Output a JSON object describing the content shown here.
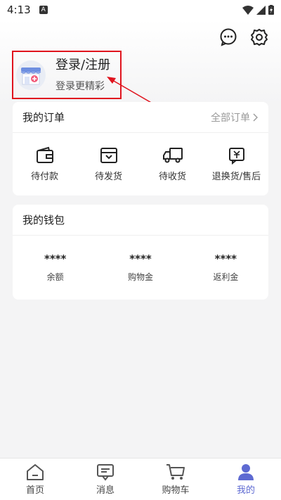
{
  "status_bar": {
    "time": "4:13",
    "badge": "A"
  },
  "profile": {
    "title": "登录/注册",
    "subtitle": "登录更精彩"
  },
  "orders": {
    "title": "我的订单",
    "all_label": "全部订单",
    "items": [
      {
        "label": "待付款",
        "icon": "wallet-icon"
      },
      {
        "label": "待发货",
        "icon": "package-icon"
      },
      {
        "label": "待收货",
        "icon": "truck-icon"
      },
      {
        "label": "退换货/售后",
        "icon": "refund-icon"
      }
    ]
  },
  "wallet": {
    "title": "我的钱包",
    "items": [
      {
        "value": "****",
        "label": "余额"
      },
      {
        "value": "****",
        "label": "购物金"
      },
      {
        "value": "****",
        "label": "返利金"
      }
    ]
  },
  "tabbar": {
    "items": [
      {
        "label": "首页",
        "icon": "home-icon"
      },
      {
        "label": "消息",
        "icon": "message-icon"
      },
      {
        "label": "购物车",
        "icon": "cart-icon"
      },
      {
        "label": "我的",
        "icon": "user-icon"
      }
    ],
    "active_index": 3
  },
  "colors": {
    "accent": "#5e6ad2",
    "highlight": "#e0141e"
  }
}
